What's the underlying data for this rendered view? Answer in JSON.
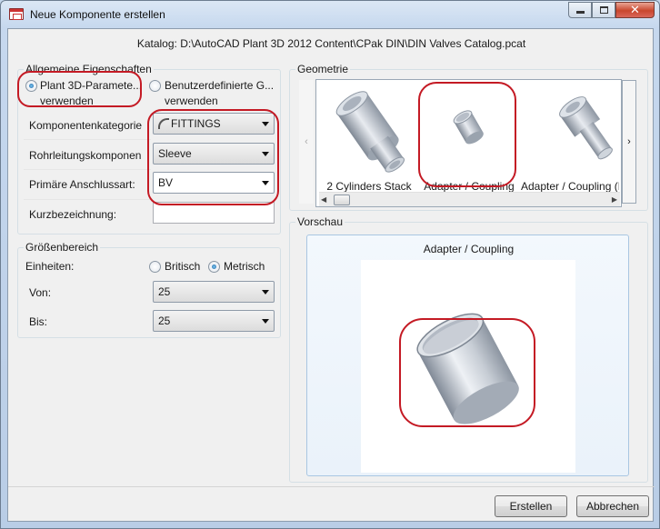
{
  "window": {
    "title": "Neue Komponente erstellen",
    "app_icon": "dialog-app-icon",
    "caption_buttons": {
      "minimize": "minimize-icon",
      "maximize": "maximize-icon",
      "close_glyph": "✕"
    }
  },
  "catalog_path": "Katalog: D:\\AutoCAD Plant 3D 2012 Content\\CPak DIN\\DIN Valves Catalog.pcat",
  "general": {
    "title": "Allgemeine Eigenschaften",
    "option_plant": {
      "line1": "Plant 3D-Paramete...",
      "line2": "verwenden",
      "selected": true
    },
    "option_custom": {
      "line1": "Benutzerdefinierte G...",
      "line2": "verwenden",
      "selected": false
    },
    "fields": [
      {
        "label": "Komponentenkategorie",
        "value": "FITTINGS",
        "icon": "elbow-fitting-icon"
      },
      {
        "label": "Rohrleitungskomponen",
        "value": "Sleeve"
      },
      {
        "label": "Primäre Anschlussart:",
        "value": "BV"
      },
      {
        "label": "Kurzbezeichnung:",
        "value": ""
      }
    ]
  },
  "size_range": {
    "title": "Größenbereich",
    "units_label": "Einheiten:",
    "unit_british": "Britisch",
    "unit_metric": "Metrisch",
    "selected_unit": "Metrisch",
    "from_label": "Von:",
    "from_value": "25",
    "to_label": "Bis:",
    "to_value": "25"
  },
  "geometry": {
    "title": "Geometrie",
    "prev_glyph": "‹",
    "next_glyph": "›",
    "items": [
      {
        "label": "2 Cylinders Stack"
      },
      {
        "label": "Adapter / Coupling",
        "selected": true
      },
      {
        "label": "Adapter / Coupling (P"
      }
    ],
    "scroll_left_glyph": "◀",
    "scroll_right_glyph": "▶"
  },
  "preview": {
    "title": "Vorschau",
    "caption": "Adapter / Coupling"
  },
  "buttons": {
    "create": "Erstellen",
    "cancel": "Abbrechen"
  },
  "colors": {
    "annotation_red": "#c41a24",
    "accent_blue": "#1f64a8"
  }
}
